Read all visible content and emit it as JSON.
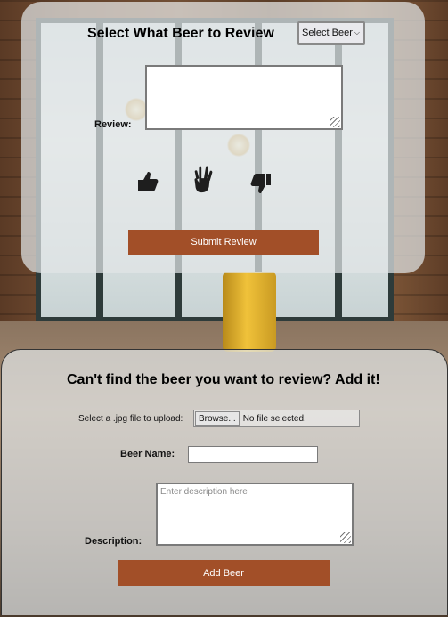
{
  "review_form": {
    "title": "Select What Beer to Review",
    "beer_select_value": "Select Beer",
    "review_label": "Review:",
    "review_text": "",
    "reactions": [
      "thumbs-up-icon",
      "vulcan-salute-icon",
      "thumbs-down-icon"
    ],
    "submit_label": "Submit Review"
  },
  "add_beer_form": {
    "title": "Can't find the beer you want to review? Add it!",
    "file_label": "Select a .jpg file to upload:",
    "browse_label": "Browse...",
    "file_status": "No file selected.",
    "name_label": "Beer Name:",
    "name_value": "",
    "description_label": "Description:",
    "description_placeholder": "Enter description here",
    "add_label": "Add Beer"
  },
  "colors": {
    "button": "#a24f28",
    "panel": "rgba(225,228,230,0.72)"
  }
}
